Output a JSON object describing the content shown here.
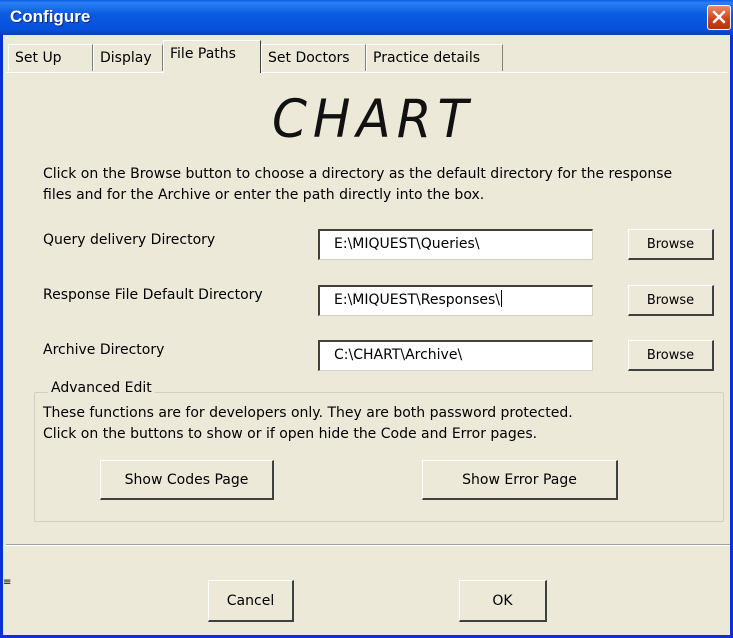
{
  "window": {
    "title": "Configure",
    "close_icon": "close-x-icon"
  },
  "tabs": [
    {
      "label": "Set Up",
      "active": false
    },
    {
      "label": "Display",
      "active": false
    },
    {
      "label": "File Paths",
      "active": true
    },
    {
      "label": "Set Doctors",
      "active": false
    },
    {
      "label": "Practice details",
      "active": false
    }
  ],
  "logo_text": "CHART",
  "intro_text": "Click on the Browse button to choose a directory as the default directory for the response files and for the Archive or enter the path directly into the box.",
  "fields": [
    {
      "label": "Query delivery Directory",
      "value": "E:\\MIQUEST\\Queries\\",
      "button": "Browse"
    },
    {
      "label": "Response File Default Directory",
      "value": "E:\\MIQUEST\\Responses\\",
      "button": "Browse"
    },
    {
      "label": "Archive Directory",
      "value": "C:\\CHART\\Archive\\",
      "button": "Browse"
    }
  ],
  "advanced": {
    "legend": "Advanced Edit",
    "line1": "These functions are for developers only. They are both password protected.",
    "line2": "Click on the buttons to show or if open hide the Code and Error pages.",
    "show_codes_label": "Show Codes Page",
    "show_error_label": "Show Error Page"
  },
  "footer": {
    "cancel_label": "Cancel",
    "ok_label": "OK"
  },
  "colors": {
    "titlebar": "#0a5fe3",
    "dialog_bg": "#ece9d8",
    "close_button": "#d0441a"
  }
}
